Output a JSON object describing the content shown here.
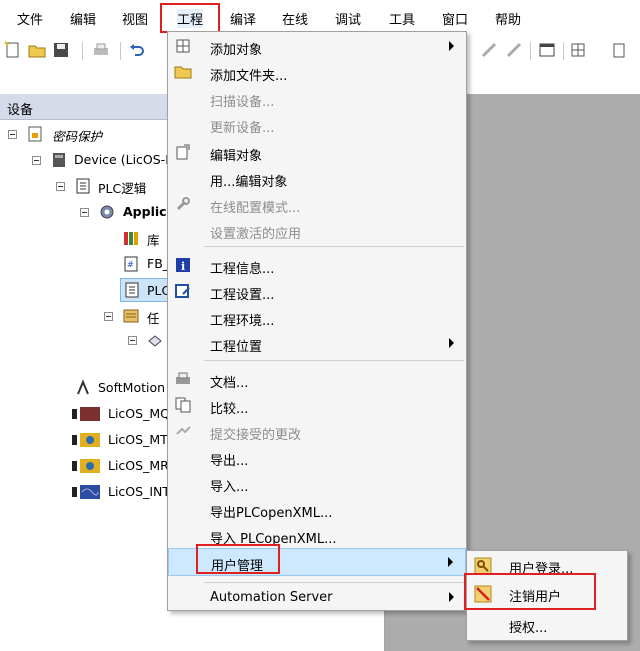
{
  "menubar": {
    "items": [
      "文件",
      "编辑",
      "视图",
      "工程",
      "编译",
      "在线",
      "调试",
      "工具",
      "窗口",
      "帮助"
    ]
  },
  "devices_panel": {
    "title": "设备",
    "tree": [
      {
        "label": "密码保护"
      },
      {
        "label": "Device (LicOS-P"
      },
      {
        "label": "PLC逻辑"
      },
      {
        "label": "Applica"
      },
      {
        "label": "库"
      },
      {
        "label": "FB_"
      },
      {
        "label": "PLC"
      },
      {
        "label": "任"
      },
      {
        "label": ""
      },
      {
        "label": "SoftMotion"
      },
      {
        "label": "LicOS_MQ"
      },
      {
        "label": "LicOS_MT"
      },
      {
        "label": "LicOS_MR"
      },
      {
        "label": "LicOS_INT"
      }
    ]
  },
  "project_menu": {
    "items": [
      {
        "label": "添加对象"
      },
      {
        "label": "添加文件夹..."
      },
      {
        "label": "扫描设备..."
      },
      {
        "label": "更新设备..."
      },
      {
        "label": "编辑对象"
      },
      {
        "label": "用...编辑对象"
      },
      {
        "label": "在线配置模式..."
      },
      {
        "label": "设置激活的应用"
      },
      {
        "label": "工程信息..."
      },
      {
        "label": "工程设置..."
      },
      {
        "label": "工程环境..."
      },
      {
        "label": "工程位置"
      },
      {
        "label": "文档..."
      },
      {
        "label": "比较..."
      },
      {
        "label": "提交接受的更改"
      },
      {
        "label": "导出..."
      },
      {
        "label": "导入..."
      },
      {
        "label": "导出PLCopenXML..."
      },
      {
        "label": "导入 PLCopenXML..."
      },
      {
        "label": "用户管理"
      },
      {
        "label": "Automation Server"
      }
    ]
  },
  "user_submenu": {
    "items": [
      {
        "label": "用户登录..."
      },
      {
        "label": "注销用户"
      },
      {
        "label": "授权..."
      }
    ]
  },
  "colors": {
    "highlight_box": "#e02020",
    "menu_hover": "#cde8ff",
    "panel_header": "#d6dbe9",
    "workspace": "#acacac"
  }
}
